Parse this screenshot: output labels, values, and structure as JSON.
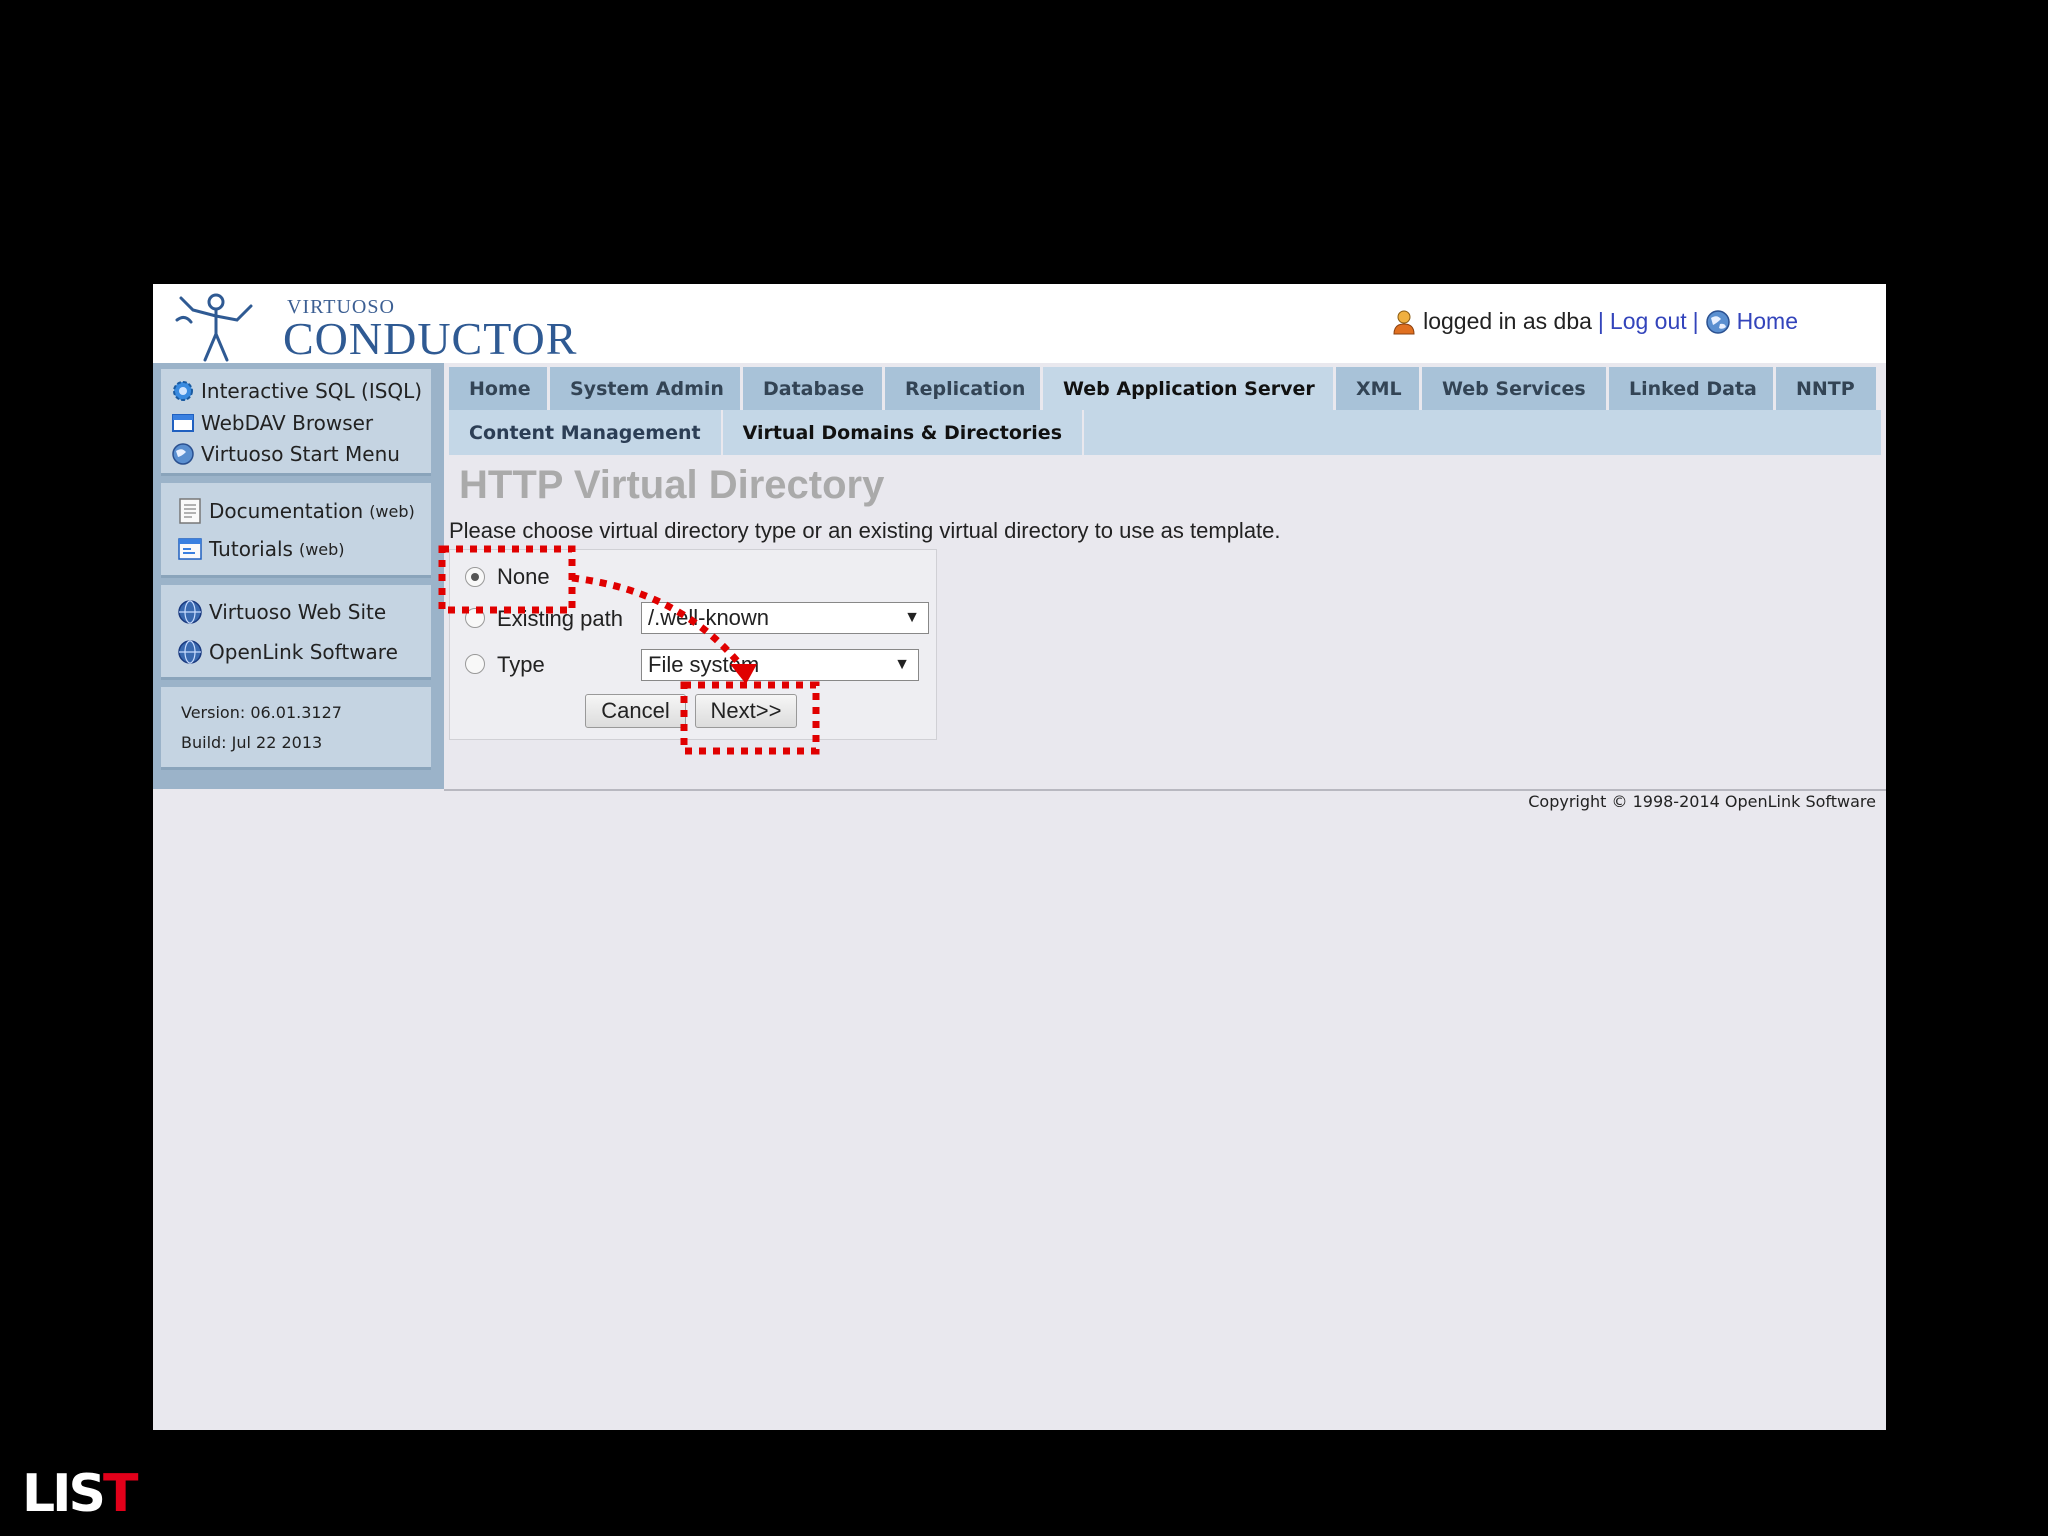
{
  "header": {
    "logo_small": "VIRTUOSO",
    "logo_big": "CONDUCTOR",
    "logged_in_text": "logged in as dba",
    "separator": "|",
    "logout_label": "Log out",
    "home_label": "Home"
  },
  "sidebar": {
    "group1": [
      {
        "label": "Interactive SQL (ISQL)",
        "icon": "gear-icon"
      },
      {
        "label": "WebDAV Browser",
        "icon": "folder-icon"
      },
      {
        "label": "Virtuoso Start Menu",
        "icon": "globe-icon"
      }
    ],
    "group2": [
      {
        "label": "Documentation",
        "suffix": "(web)",
        "icon": "document-icon"
      },
      {
        "label": "Tutorials",
        "suffix": "(web)",
        "icon": "tutorial-icon"
      }
    ],
    "group3": [
      {
        "label": "Virtuoso Web Site",
        "icon": "web-globe-icon"
      },
      {
        "label": "OpenLink Software",
        "icon": "web-globe-icon"
      }
    ],
    "version": "Version: 06.01.3127",
    "build": "Build: Jul 22 2013"
  },
  "tabs": [
    {
      "label": "Home",
      "active": false
    },
    {
      "label": "System Admin",
      "active": false
    },
    {
      "label": "Database",
      "active": false
    },
    {
      "label": "Replication",
      "active": false
    },
    {
      "label": "Web Application Server",
      "active": true
    },
    {
      "label": "XML",
      "active": false
    },
    {
      "label": "Web Services",
      "active": false
    },
    {
      "label": "Linked Data",
      "active": false
    },
    {
      "label": "NNTP",
      "active": false
    }
  ],
  "subtabs": [
    {
      "label": "Content Management",
      "active": false
    },
    {
      "label": "Virtual Domains & Directories",
      "active": true
    }
  ],
  "main": {
    "title": "HTTP Virtual Directory",
    "instruction": "Please choose virtual directory type or an existing virtual directory to use as template.",
    "form": {
      "none_label": "None",
      "none_checked": true,
      "existing_label": "Existing path",
      "existing_value": "/.well-known",
      "type_label": "Type",
      "type_value": "File system",
      "cancel_label": "Cancel",
      "next_label": "Next>>"
    }
  },
  "footer": {
    "copyright": "Copyright © 1998-2014 OpenLink Software"
  },
  "annotation": {
    "color": "#e00000"
  },
  "slide_logo": {
    "text_main": "LIS",
    "text_accent": "T",
    "main_color": "#ffffff",
    "accent_color": "#e2001a"
  }
}
